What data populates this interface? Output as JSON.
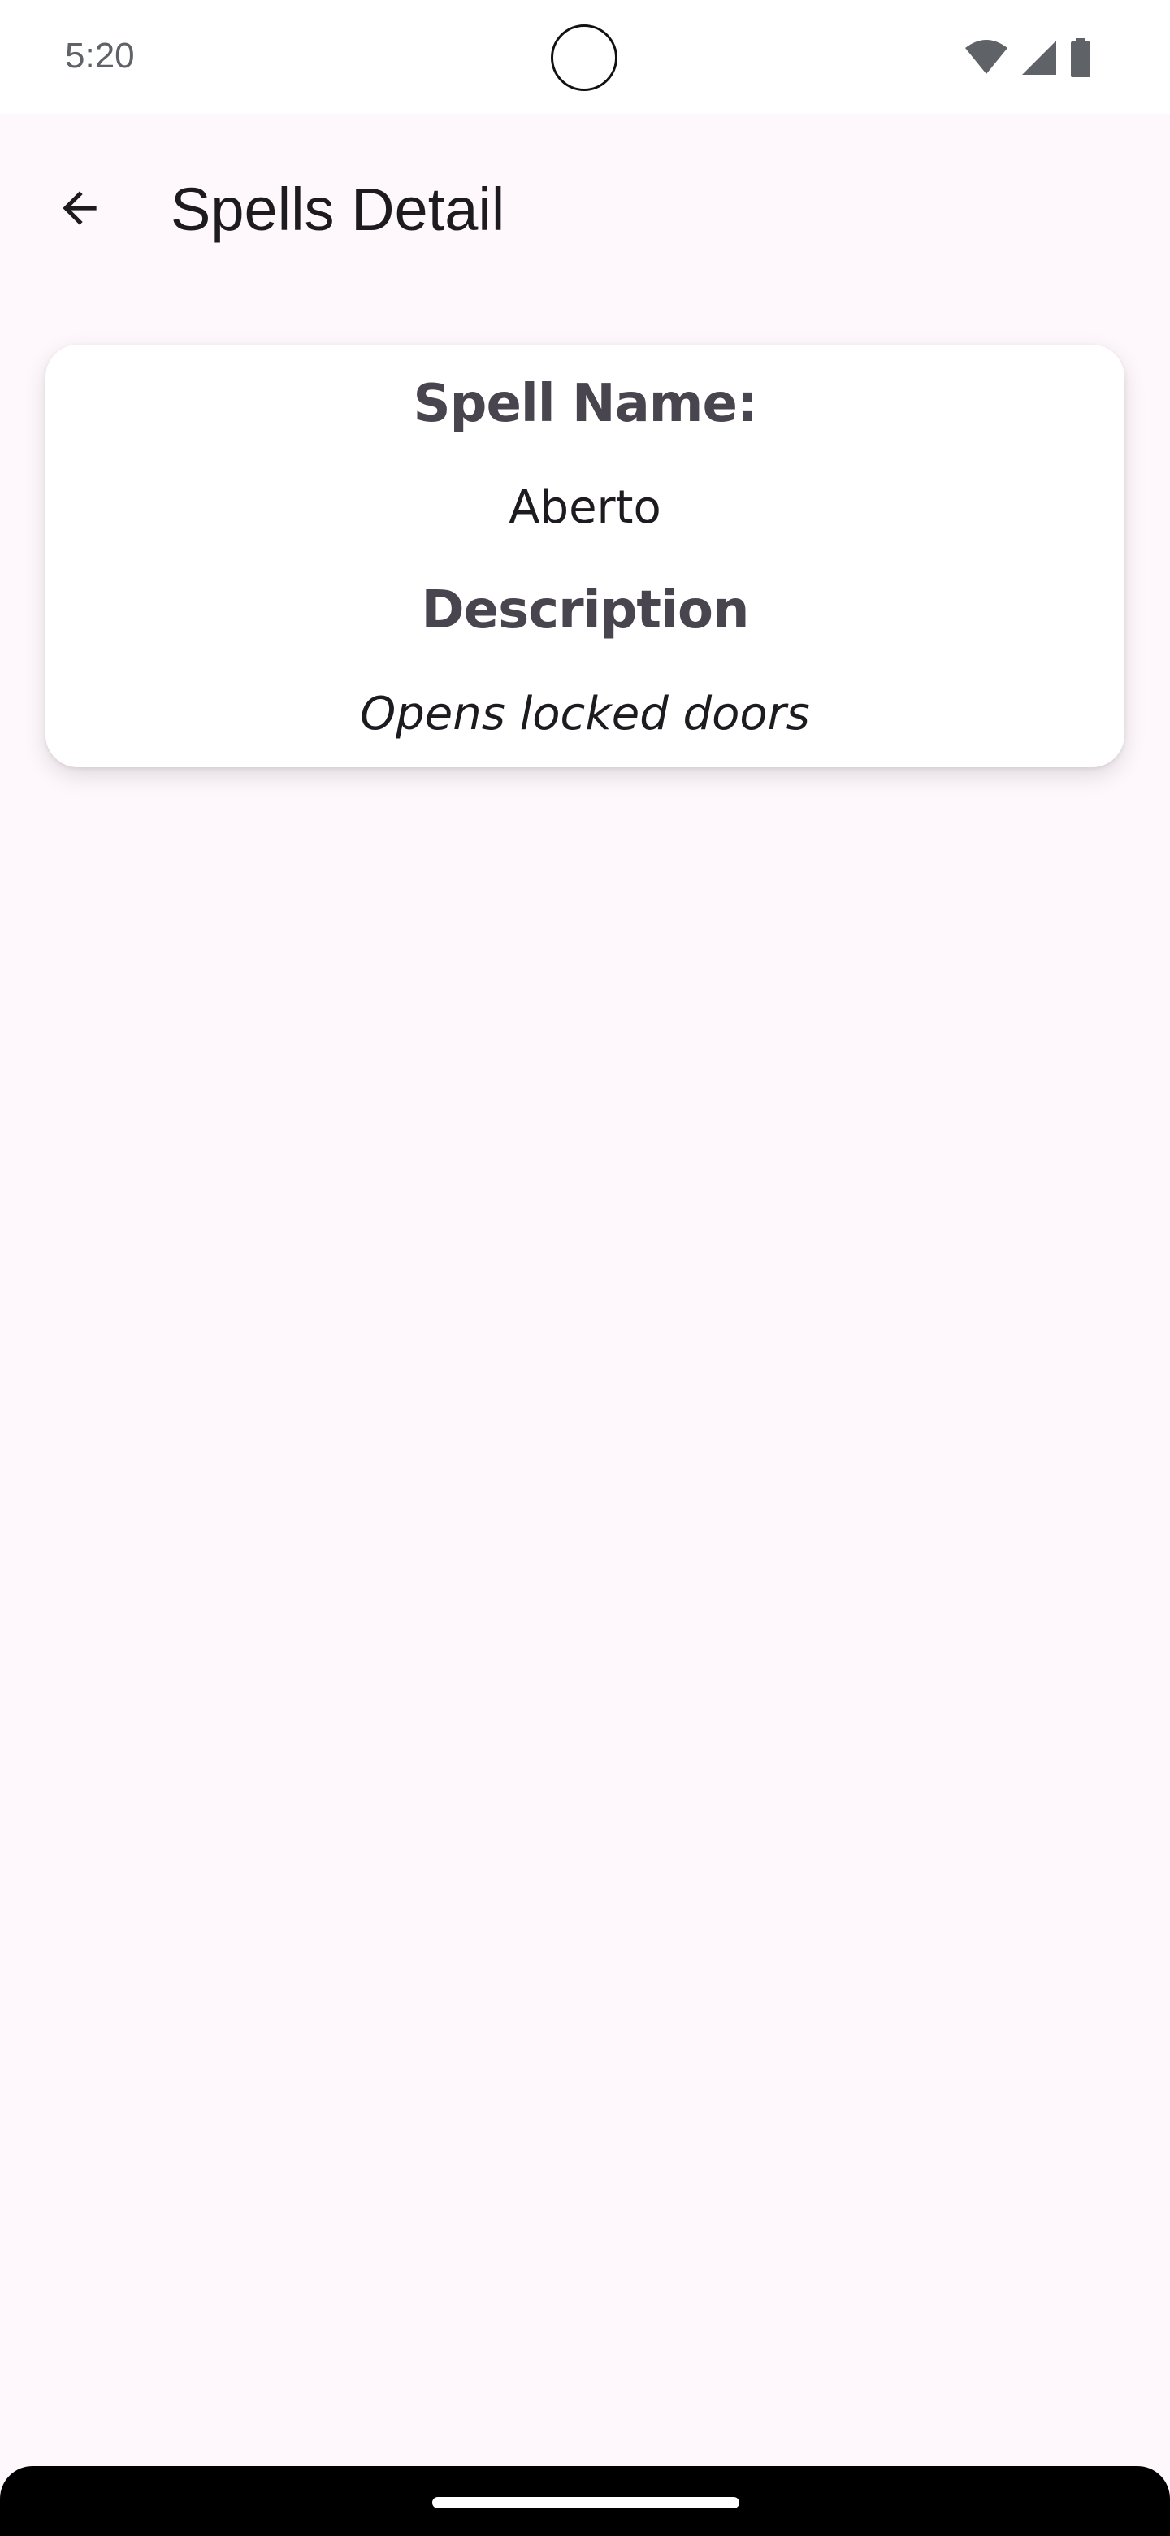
{
  "status_bar": {
    "time": "5:20",
    "icons": [
      "wifi-icon",
      "cellular-signal-icon",
      "battery-icon"
    ]
  },
  "app_bar": {
    "title": "Spells Detail",
    "back_icon": "arrow-back-icon"
  },
  "spell": {
    "name_label": "Spell Name:",
    "name": "Aberto",
    "description_label": "Description",
    "description": "Opens locked doors"
  },
  "colors": {
    "background": "#fef7fb",
    "card": "#ffffff",
    "label_text": "#49454f",
    "value_text": "#1d1b20"
  }
}
